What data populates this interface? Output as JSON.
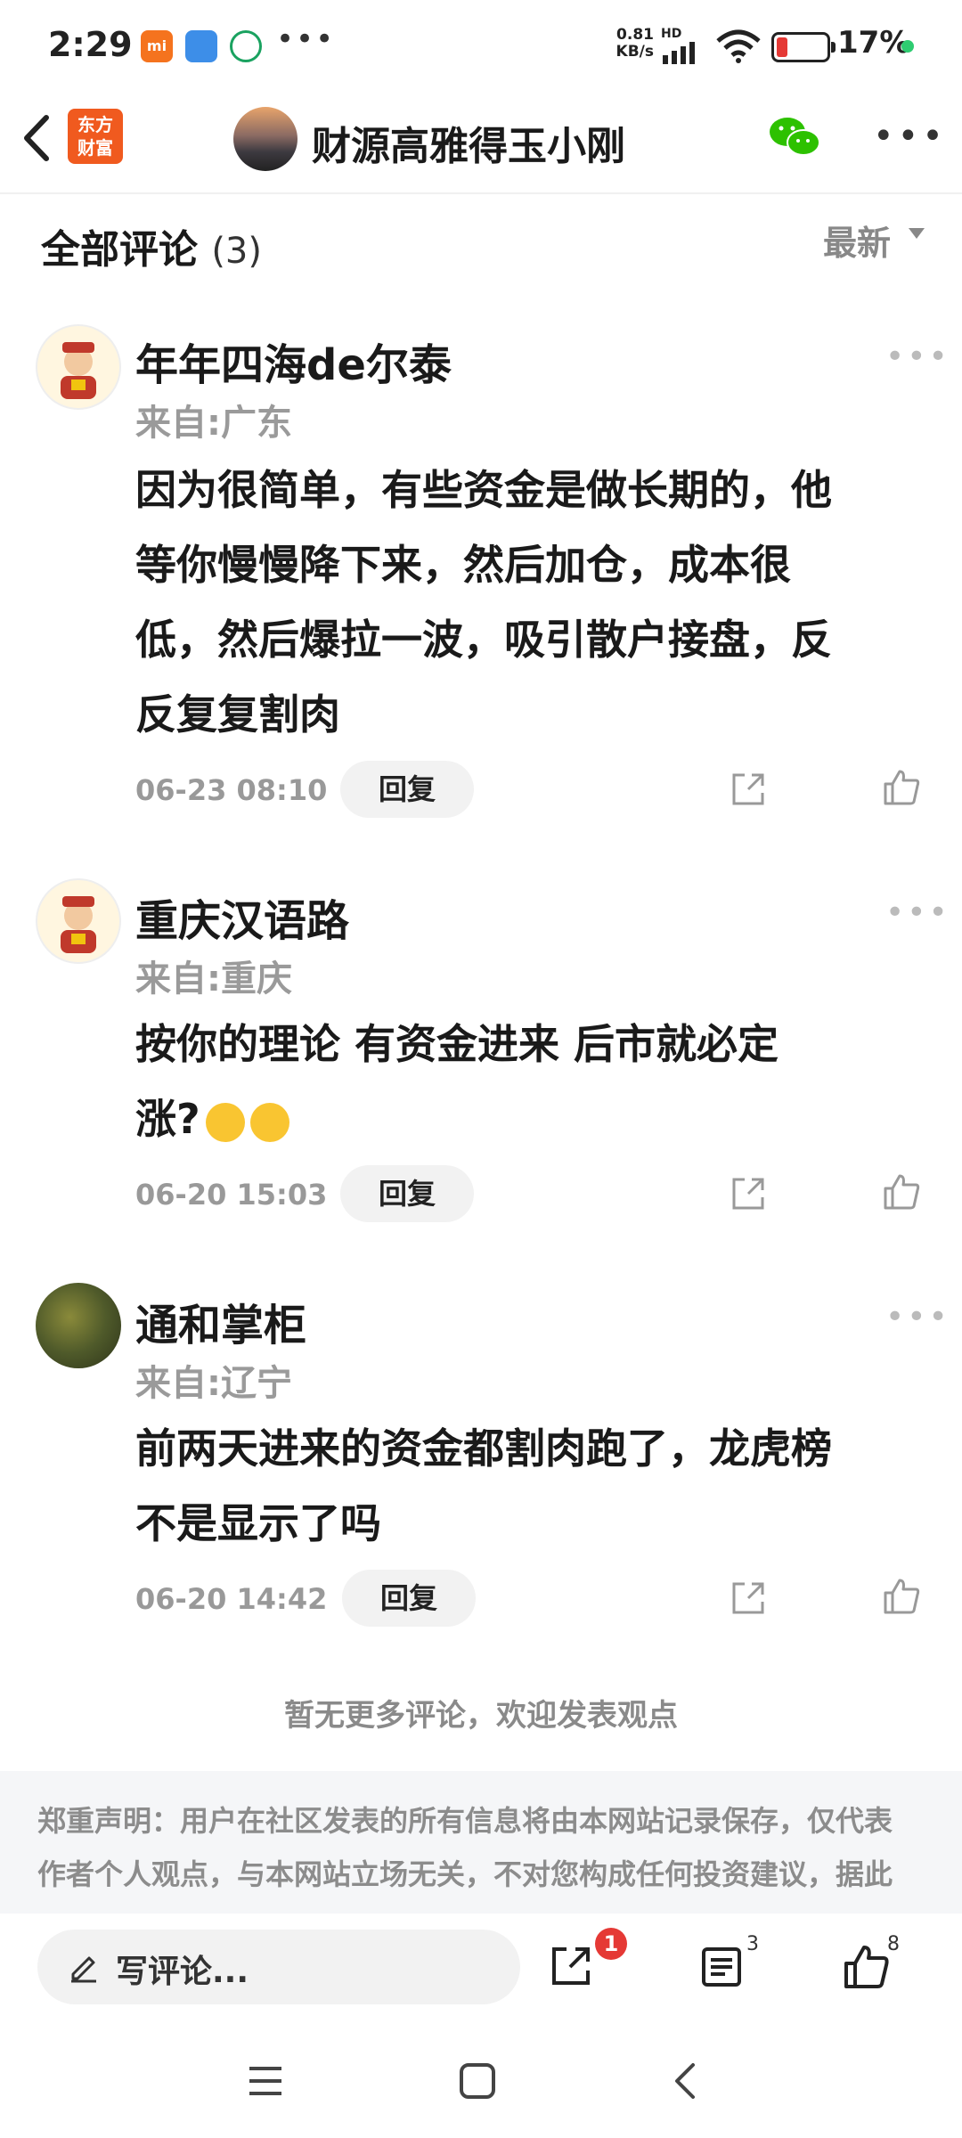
{
  "status_bar": {
    "time": "2:29",
    "net_speed_value": "0.81",
    "net_speed_unit": "KB/s",
    "network_type": "HD",
    "battery_percent": "17%"
  },
  "header": {
    "logo_line1": "东方",
    "logo_line2": "财富",
    "title": "财源高雅得玉小刚"
  },
  "comments_header": {
    "label": "全部评论",
    "count": "(3)",
    "sort_label": "最新"
  },
  "comments": [
    {
      "username": "年年四海de尔泰",
      "location": "来自:广东",
      "text_lines": [
        "因为很简单，有些资金是做长期的，他",
        "等你慢慢降下来，然后加仓，成本很",
        "低，然后爆拉一波，吸引散户接盘，反",
        "反复复割肉"
      ],
      "date": "06-23 08:10",
      "reply_label": "回复"
    },
    {
      "username": "重庆汉语路",
      "location": "来自:重庆",
      "text_lines": [
        "按你的理论  有资金进来  后市就必定",
        "涨?"
      ],
      "date": "06-20 15:03",
      "reply_label": "回复"
    },
    {
      "username": "通和掌柜",
      "location": "来自:辽宁",
      "text_lines": [
        "前两天进来的资金都割肉跑了，龙虎榜",
        "不是显示了吗"
      ],
      "date": "06-20 14:42",
      "reply_label": "回复"
    }
  ],
  "no_more_text": "暂无更多评论，欢迎发表观点",
  "disclaimer_lines": [
    "郑重声明：用户在社区发表的所有信息将由本网站记录保存，仅代表",
    "作者个人观点，与本网站立场无关，不对您构成任何投资建议，据此"
  ],
  "bottom_bar": {
    "write_placeholder": "写评论...",
    "share_badge": "1",
    "comment_count": "3",
    "like_count": "8"
  }
}
